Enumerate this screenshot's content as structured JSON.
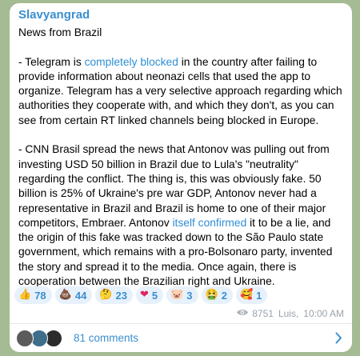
{
  "post": {
    "channel": "Slavyangrad",
    "heading": "News from Brazil",
    "p1_prefix": "- Telegram is ",
    "p1_link": "completely blocked",
    "p1_suffix": " in the country after failing to provide information about neonazi cells that used the app to organize. Telegram has a very selective approach regarding which authorities they cooperate with, and which they don't, as you can see from certain RT linked channels being blocked in Europe.",
    "p2_prefix": "- CNN Brasil spread the news that Antonov was pulling out from investing USD 50 billion in Brazil due to Lula's \"neutrality\" regarding the conflict. The thing is, this was obviously fake. 50 billion is 25% of Ukraine's pre war GDP, Antonov never had a representative in Brazil and Brazil is home to one of their major competitors, Embraer. Antonov ",
    "p2_link": "itself confirmed",
    "p2_suffix": " it to be a lie, and the origin of this fake was tracked down to the São Paulo state government, which remains with a pro-Bolsonaro party, invented the story and spread it to the media. Once again, there is cooperation between the Brazilian right and Ukraine."
  },
  "reactions": [
    {
      "emoji": "👍",
      "count": "78"
    },
    {
      "emoji": "💩",
      "count": "44"
    },
    {
      "emoji": "🤔",
      "count": "23"
    },
    {
      "emoji": "❤",
      "count": "5"
    },
    {
      "emoji": "🐷",
      "count": "3"
    },
    {
      "emoji": "🤮",
      "count": "2"
    },
    {
      "emoji": "🥰",
      "count": "1"
    }
  ],
  "meta": {
    "views": "8751",
    "author": "Luis,",
    "time": "10:00 AM"
  },
  "comments": {
    "label": "81 comments"
  },
  "icons": {
    "views": "eye-icon",
    "comments_arrow": "chevron-right-icon"
  },
  "colors": {
    "background": "#a5bb93",
    "accent": "#3a8fd0",
    "link": "#2f8fd6",
    "reaction_bg": "#e7f1fb",
    "meta": "#9aa3ab"
  }
}
